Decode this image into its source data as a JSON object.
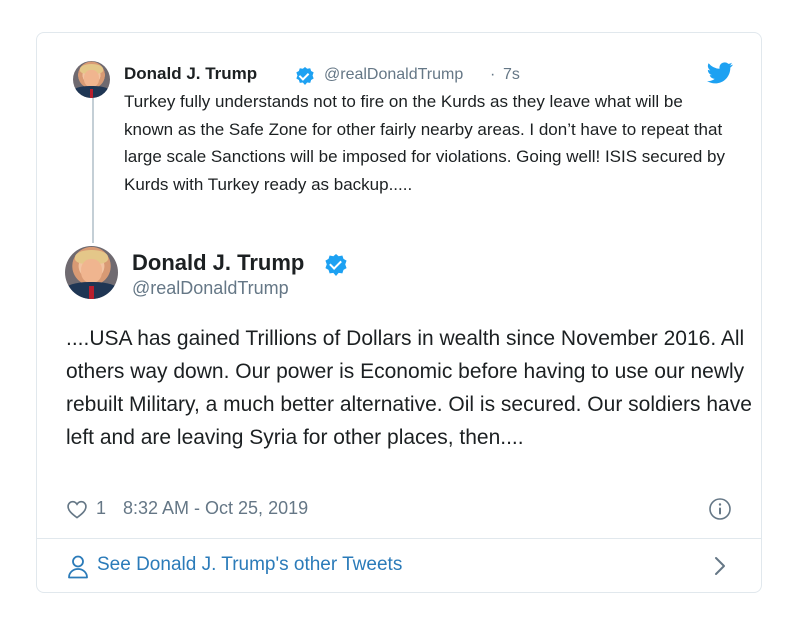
{
  "quoted_tweet": {
    "display_name": "Donald J. Trump",
    "handle": "@realDonaldTrump",
    "separator": "·",
    "time": "7s",
    "text": "Turkey fully understands not to fire on the Kurds as they leave what will be known as the Safe Zone for other fairly nearby areas. I don’t have to repeat that large scale Sanctions will be imposed for violations. Going well! ISIS secured by Kurds with Turkey ready as backup....."
  },
  "main_tweet": {
    "display_name": "Donald J. Trump",
    "handle": "@realDonaldTrump",
    "text": "....USA has gained Trillions of Dollars in wealth since November 2016. All others way down. Our power is Economic before having to use our newly rebuilt Military, a much better alternative. Oil is secured. Our soldiers have left and are leaving Syria for other places, then....",
    "like_count": "1",
    "timestamp": "8:32 AM - Oct 25, 2019"
  },
  "footer": {
    "see_other_label": "See Donald J. Trump's other Tweets"
  },
  "icons": {
    "twitter": "twitter-bird-icon",
    "verified": "verified-badge-icon",
    "like": "heart-icon",
    "info": "info-icon",
    "profile": "person-icon",
    "next": "chevron-right-icon"
  },
  "colors": {
    "twitter_blue": "#1da1f2",
    "link_blue": "#2b7bb9",
    "secondary_text": "#657786",
    "border": "#e1e8ed"
  }
}
